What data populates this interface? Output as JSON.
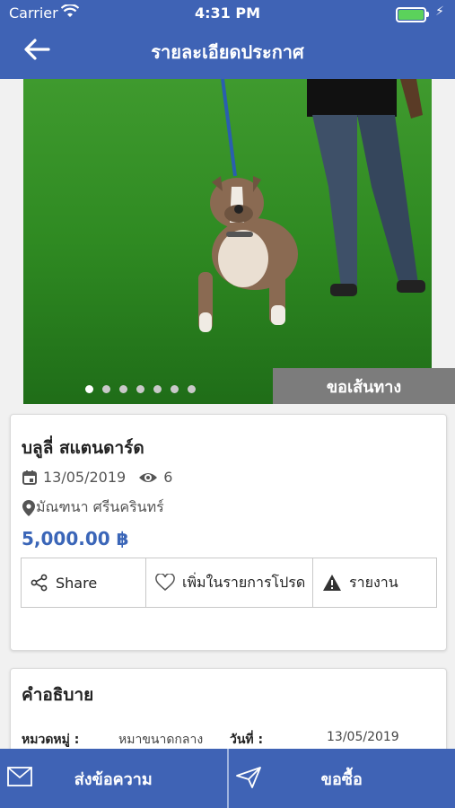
{
  "status_bar": {
    "carrier": "Carrier",
    "time": "4:31 PM"
  },
  "header": {
    "title": "รายละเอียดประกาศ"
  },
  "slider": {
    "total_images": 7,
    "active_index": 0,
    "route_label": "ขอเส้นทาง"
  },
  "listing": {
    "title": "บลูลี่ สแตนดาร์ด",
    "date": "13/05/2019",
    "views": "6",
    "location": "มัณฑนา ศรีนครินทร์",
    "price": "5,000.00 ฿"
  },
  "actions": {
    "share": "Share",
    "favorite": "เพิ่มในรายการโปรด",
    "report": "รายงาน"
  },
  "description": {
    "title": "คำอธิบาย",
    "category_label": "หมวดหมู่ :",
    "category_value": "หมาขนาดกลาง",
    "date_label": "วันที่ :",
    "date_value": "13/05/2019"
  },
  "bottom": {
    "message": "ส่งข้อความ",
    "buy": "ขอซื้อ"
  },
  "colors": {
    "primary": "#3f63b5",
    "price": "#3b66b8",
    "route_button": "#7c7c7c"
  }
}
